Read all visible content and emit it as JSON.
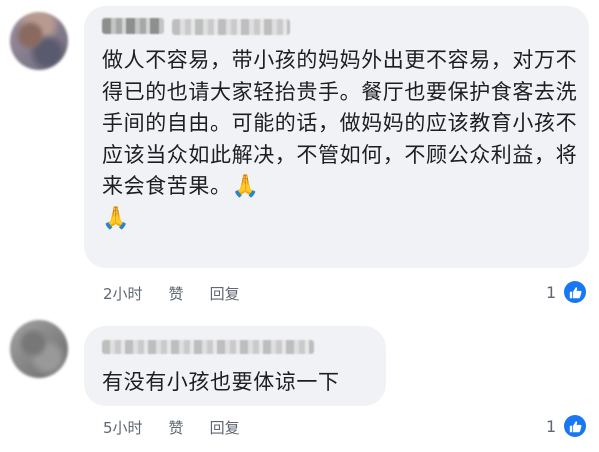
{
  "comments": [
    {
      "text": "做人不容易，带小孩的妈妈外出更不容易，对万不得已的也请大家轻抬贵手。餐厅也要保护食客去洗手间的自由。可能的话，做妈妈的应该教育小孩不应该当众如此解决，不管如何，不顾公众利益，将来会食苦果。",
      "emoji": "🙏",
      "emoji_icon": "folded-hands-icon",
      "time": "2小时",
      "like_action": "赞",
      "reply_action": "回复",
      "like_count": "1"
    },
    {
      "text": "有没有小孩也要体谅一下",
      "time": "5小时",
      "like_action": "赞",
      "reply_action": "回复",
      "like_count": "1"
    }
  ],
  "colors": {
    "bubble": "#f0f2f5",
    "meta_text": "#606770",
    "like_badge": "#1877f2"
  }
}
